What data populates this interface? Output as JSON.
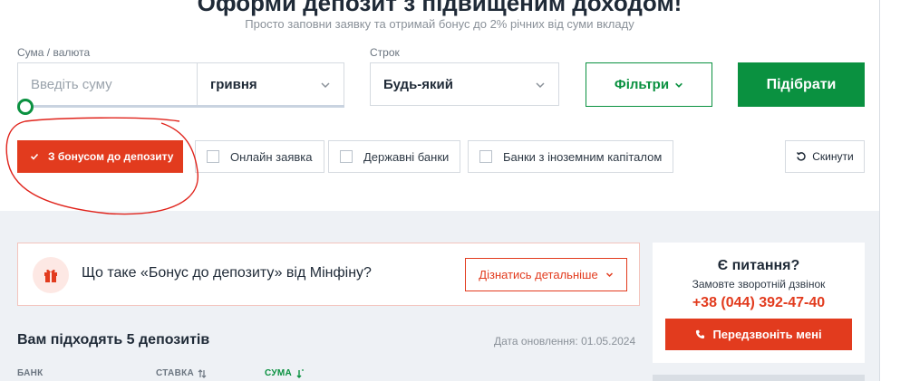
{
  "hero": {
    "title": "Оформи депозит з підвищеним доходом!",
    "subtitle": "Просто заповни заявку та отримай бонус до 2% річних від суми вкладу"
  },
  "form": {
    "amount_label": "Сума / валюта",
    "amount_placeholder": "Введіть суму",
    "currency_value": "гривня",
    "term_label": "Строк",
    "term_value": "Будь-який",
    "filters_label": "Фільтри",
    "submit_label": "Підібрати",
    "slider_value": 0
  },
  "chips": {
    "bonus": {
      "label": "З бонусом до депозиту",
      "checked": true
    },
    "online": {
      "label": "Онлайн заявка",
      "checked": false
    },
    "state": {
      "label": "Державні банки",
      "checked": false
    },
    "foreign": {
      "label": "Банки з іноземним капіталом",
      "checked": false
    },
    "reset_label": "Скинути"
  },
  "bonus_info": {
    "text": "Що таке «Бонус до депозиту» від Мінфіну?",
    "button_label": "Дізнатись детальніше"
  },
  "callback": {
    "title": "Є питання?",
    "subtitle": "Замовте зворотній дзвінок",
    "phone": "+38 (044) 392-47-40",
    "button_label": "Передзвоніть мені"
  },
  "results": {
    "title": "Вам підходять 5 депозитів",
    "updated": "Дата оновлення: 01.05.2024",
    "columns": [
      "БАНК",
      "СТАВКА",
      "СУМА"
    ]
  },
  "colors": {
    "accent_green": "#0a9140",
    "accent_red": "#e23b1e",
    "annotation_red": "#e0231b"
  },
  "icons": [
    "chevron-down-icon",
    "check-icon",
    "reset-icon",
    "gift-icon",
    "phone-icon",
    "sort-icon"
  ]
}
